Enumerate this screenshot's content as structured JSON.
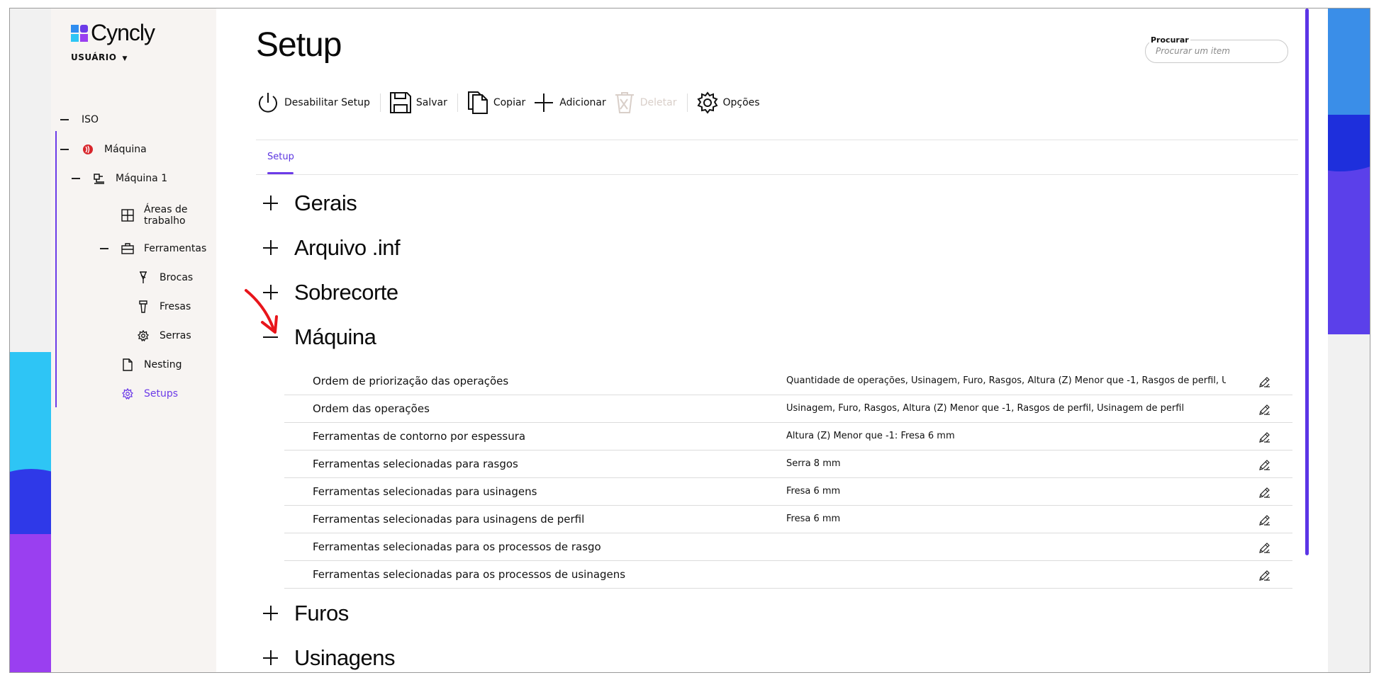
{
  "app": {
    "logo_text": "Cyncly",
    "user_label": "USUÁRIO"
  },
  "page": {
    "title": "Setup"
  },
  "search": {
    "label": "Procurar",
    "placeholder": "Procurar um item"
  },
  "sidebar": {
    "items": [
      {
        "label": "ISO",
        "icon": "dash-icon"
      },
      {
        "label": "Máquina",
        "icon": "machine-brand-icon"
      },
      {
        "label": "Máquina 1",
        "icon": "machine-icon"
      },
      {
        "label": "Áreas de trabalho",
        "icon": "grid-icon"
      },
      {
        "label": "Ferramentas",
        "icon": "toolbox-icon"
      },
      {
        "label": "Brocas",
        "icon": "drill-bit-icon"
      },
      {
        "label": "Fresas",
        "icon": "mill-icon"
      },
      {
        "label": "Serras",
        "icon": "saw-gear-icon"
      },
      {
        "label": "Nesting",
        "icon": "document-icon"
      },
      {
        "label": "Setups",
        "icon": "gear-icon"
      }
    ],
    "active_color": "#6c3be8"
  },
  "toolbar": {
    "disable_label": "Desabilitar Setup",
    "save_label": "Salvar",
    "copy_label": "Copiar",
    "add_label": "Adicionar",
    "delete_label": "Deletar",
    "options_label": "Opções"
  },
  "tabs": [
    {
      "label": "Setup"
    }
  ],
  "sections": {
    "gerais": "Gerais",
    "arquivo": "Arquivo .inf",
    "sobrecorte": "Sobrecorte",
    "maquina": "Máquina",
    "furos": "Furos",
    "usinagens": "Usinagens"
  },
  "maquina_rows": [
    {
      "name": "Ordem de priorização das operações",
      "value": "Quantidade de operações, Usinagem, Furo, Rasgos, Altura (Z) Menor que -1, Rasgos de perfil, Usinagem de perfil"
    },
    {
      "name": "Ordem das operações",
      "value": "Usinagem, Furo, Rasgos, Altura (Z) Menor que -1, Rasgos de perfil, Usinagem de perfil"
    },
    {
      "name": "Ferramentas de contorno por espessura",
      "value": "Altura (Z) Menor que -1: Fresa 6 mm"
    },
    {
      "name": "Ferramentas selecionadas para rasgos",
      "value": "Serra 8 mm"
    },
    {
      "name": "Ferramentas selecionadas para usinagens",
      "value": "Fresa 6 mm"
    },
    {
      "name": "Ferramentas selecionadas para usinagens de perfil",
      "value": "Fresa 6 mm"
    },
    {
      "name": "Ferramentas selecionadas para os processos de rasgo",
      "value": ""
    },
    {
      "name": "Ferramentas selecionadas para os processos de usinagens",
      "value": ""
    }
  ],
  "colors": {
    "accent": "#6c3be8",
    "annotation_arrow": "#e8151b"
  }
}
